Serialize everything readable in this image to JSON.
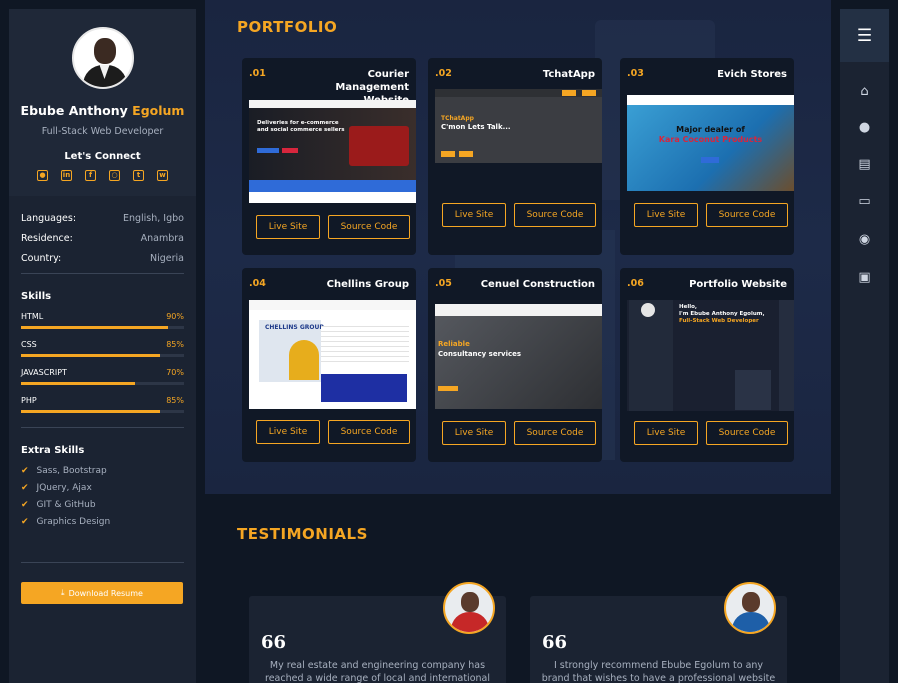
{
  "sidebar": {
    "name_first": "Ebube Anthony ",
    "name_last": "Egolum",
    "role": "Full-Stack Web Developer",
    "connect_label": "Let's Connect",
    "socials": [
      "github-icon",
      "linkedin-icon",
      "facebook-icon",
      "instagram-icon",
      "twitter-icon",
      "whatsapp-icon"
    ],
    "info": [
      {
        "key": "Languages:",
        "value": "English, Igbo"
      },
      {
        "key": "Residence:",
        "value": "Anambra"
      },
      {
        "key": "Country:",
        "value": "Nigeria"
      }
    ],
    "skills_title": "Skills",
    "skills": [
      {
        "name": "HTML",
        "percent": "90%",
        "level": 0.9
      },
      {
        "name": "CSS",
        "percent": "85%",
        "level": 0.85
      },
      {
        "name": "JAVASCRIPT",
        "percent": "70%",
        "level": 0.7
      },
      {
        "name": "PHP",
        "percent": "85%",
        "level": 0.85
      }
    ],
    "extra_title": "Extra Skills",
    "extra_skills": [
      "Sass, Bootstrap",
      "JQuery, Ajax",
      "GIT & GitHub",
      "Graphics Design"
    ],
    "resume_label": "Download Resume"
  },
  "portfolio": {
    "heading": "PORTFOLIO",
    "live_label": "Live Site",
    "source_label": "Source Code",
    "projects": [
      {
        "num": ".01",
        "title": "Courier Management Website",
        "shot_text": "Deliveries for e-commerce and social commerce sellers"
      },
      {
        "num": ".02",
        "title": "TchatApp",
        "shot_title": "TChatApp",
        "shot_text": "C'mon Lets Talk..."
      },
      {
        "num": ".03",
        "title": "Evich Stores",
        "shot_text": "Major dealer of",
        "shot_text2": "Kara Coconut Products"
      },
      {
        "num": ".04",
        "title": "Chellins Group",
        "shot_text": "CHELLINS GROUP"
      },
      {
        "num": ".05",
        "title": "Cenuel Construction",
        "shot_title": "Reliable",
        "shot_text": "Consultancy services"
      },
      {
        "num": ".06",
        "title": "Portfolio Website",
        "shot_title": "Hello,",
        "shot_text": "I'm Ebube Anthony Egolum,",
        "shot_text2": "Full-Stack Web Developer"
      }
    ]
  },
  "testimonials": {
    "heading": "TESTIMONIALS",
    "items": [
      {
        "quote_mark": "66",
        "text": "My real estate and engineering company has reached a wide range of local and international clients since"
      },
      {
        "quote_mark": "66",
        "text": "I strongly recommend Ebube Egolum to any brand that wishes to have a professional website for their"
      }
    ]
  },
  "nav": {
    "menu_icon": "hamburger-icon",
    "items": [
      "home-icon",
      "user-icon",
      "document-icon",
      "laptop-icon",
      "chat-icon",
      "contact-card-icon"
    ]
  },
  "colors": {
    "accent": "#f5a623",
    "panel": "#1b2332",
    "background": "#0f1724"
  }
}
